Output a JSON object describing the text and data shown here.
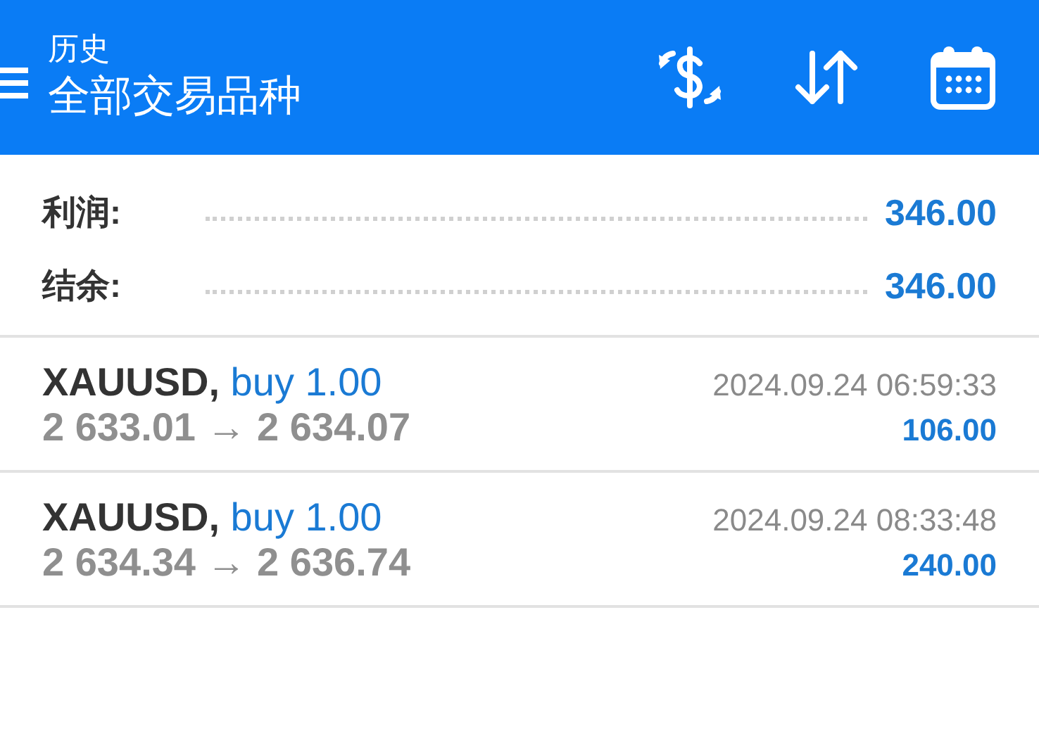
{
  "header": {
    "subtitle": "历史",
    "title": "全部交易品种"
  },
  "summary": [
    {
      "label": "利润:",
      "value": "346.00"
    },
    {
      "label": "结余:",
      "value": "346.00"
    }
  ],
  "trades": [
    {
      "symbol": "XAUUSD,",
      "side": "buy 1.00",
      "prices": "2 633.01 → 2 634.07",
      "time": "2024.09.24 06:59:33",
      "profit": "106.00"
    },
    {
      "symbol": "XAUUSD,",
      "side": "buy 1.00",
      "prices": "2 634.34 → 2 636.74",
      "time": "2024.09.24 08:33:48",
      "profit": "240.00"
    }
  ]
}
